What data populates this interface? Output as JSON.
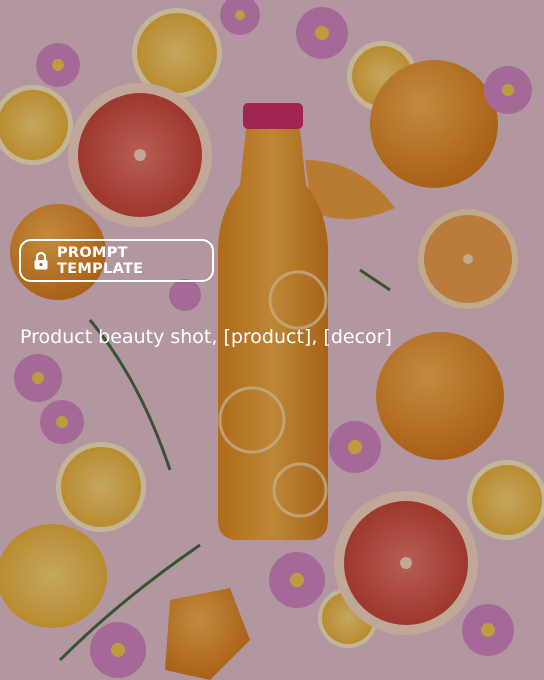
{
  "badge": {
    "label": "PROMPT TEMPLATE",
    "icon": "lock-icon"
  },
  "prompt": {
    "text": "Product beauty shot, [product], [decor]"
  },
  "colors": {
    "overlay": "#c9a8b4",
    "text": "#ffffff",
    "orange": "#f0a030",
    "grapefruit": "#e8604a",
    "cap": "#d02a6a"
  }
}
